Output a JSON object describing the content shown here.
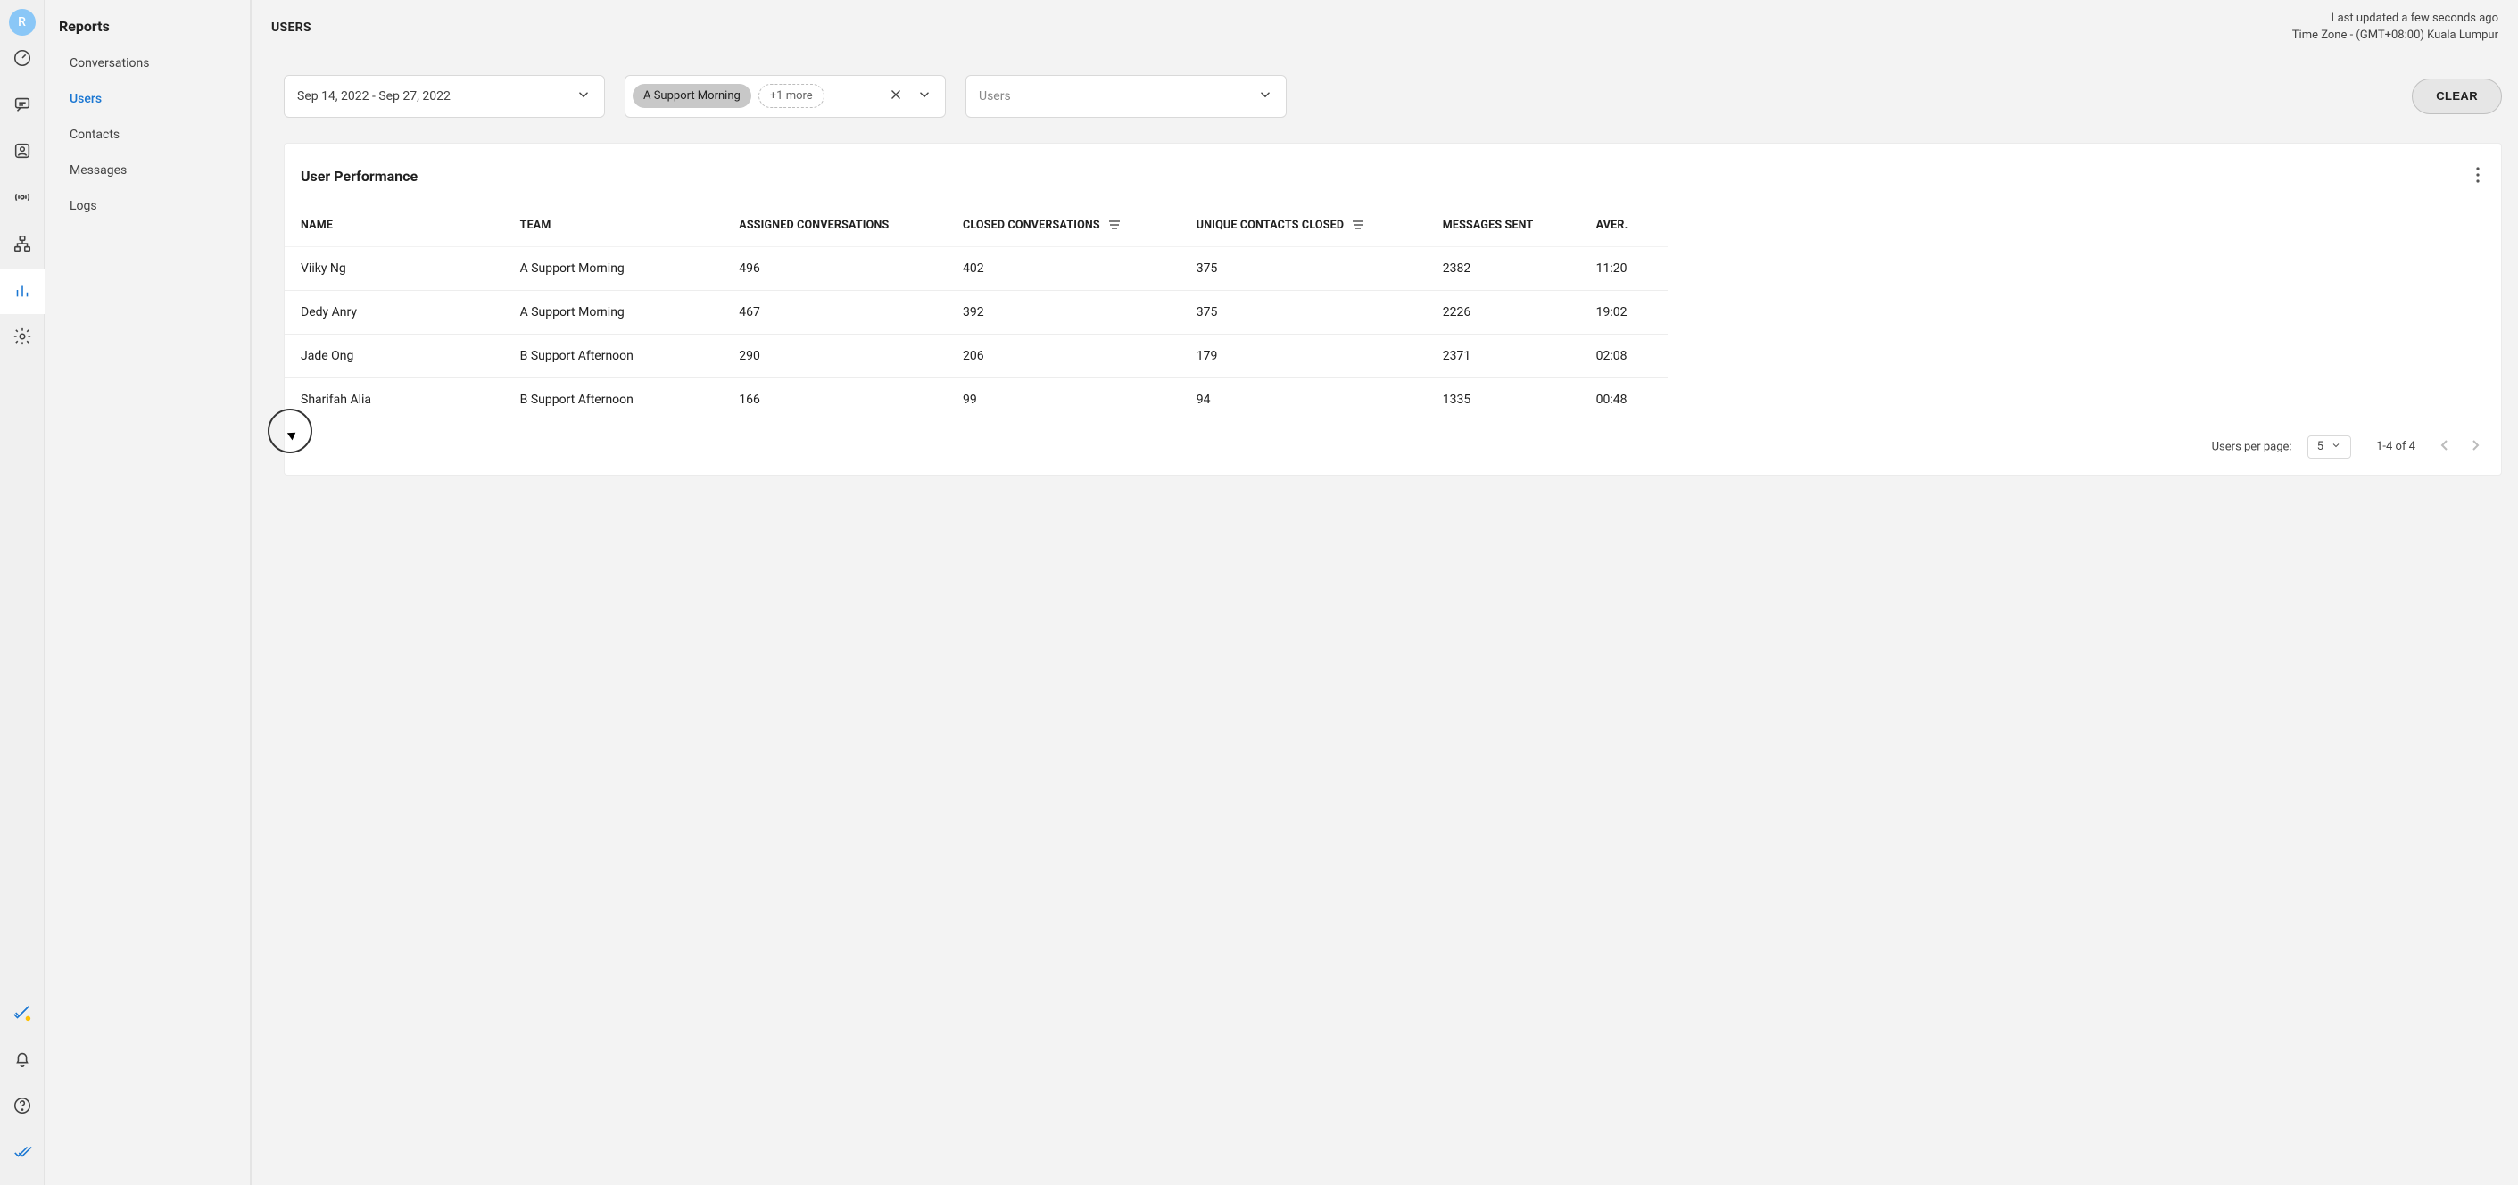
{
  "accent_color": "#1976d2",
  "avatar_letter": "R",
  "nav": {
    "items": [
      "dashboard",
      "chat",
      "contacts",
      "broadcast",
      "workflow",
      "reports",
      "settings"
    ],
    "bottom": [
      "status",
      "notifications",
      "help",
      "logo"
    ]
  },
  "sidebar": {
    "title": "Reports",
    "items": [
      {
        "label": "Conversations"
      },
      {
        "label": "Users"
      },
      {
        "label": "Contacts"
      },
      {
        "label": "Messages"
      },
      {
        "label": "Logs"
      }
    ],
    "active_index": 1
  },
  "header": {
    "title": "USERS",
    "last_updated": "Last updated a few seconds ago",
    "timezone": "Time Zone - (GMT+08:00) Kuala Lumpur"
  },
  "filters": {
    "date_range": "Sep 14, 2022 - Sep 27, 2022",
    "team_chip": "A Support Morning",
    "team_more": "+1 more",
    "users_placeholder": "Users",
    "clear_label": "CLEAR"
  },
  "card": {
    "title": "User Performance"
  },
  "table": {
    "columns": [
      "NAME",
      "TEAM",
      "ASSIGNED CONVERSATIONS",
      "CLOSED CONVERSATIONS",
      "UNIQUE CONTACTS CLOSED",
      "MESSAGES SENT",
      "AVER."
    ],
    "sorted_columns": [
      3,
      4
    ],
    "rows": [
      {
        "name": "Viiky Ng",
        "team": "A Support Morning",
        "assigned": "496",
        "closed": "402",
        "unique": "375",
        "sent": "2382",
        "avg": "11:20"
      },
      {
        "name": "Dedy Anry",
        "team": "A Support Morning",
        "assigned": "467",
        "closed": "392",
        "unique": "375",
        "sent": "2226",
        "avg": "19:02"
      },
      {
        "name": "Jade Ong",
        "team": "B Support Afternoon",
        "assigned": "290",
        "closed": "206",
        "unique": "179",
        "sent": "2371",
        "avg": "02:08"
      },
      {
        "name": "Sharifah Alia",
        "team": "B Support Afternoon",
        "assigned": "166",
        "closed": "99",
        "unique": "94",
        "sent": "1335",
        "avg": "00:48"
      }
    ]
  },
  "pager": {
    "per_page_label": "Users per page:",
    "per_page_value": "5",
    "range": "1-4 of 4"
  }
}
